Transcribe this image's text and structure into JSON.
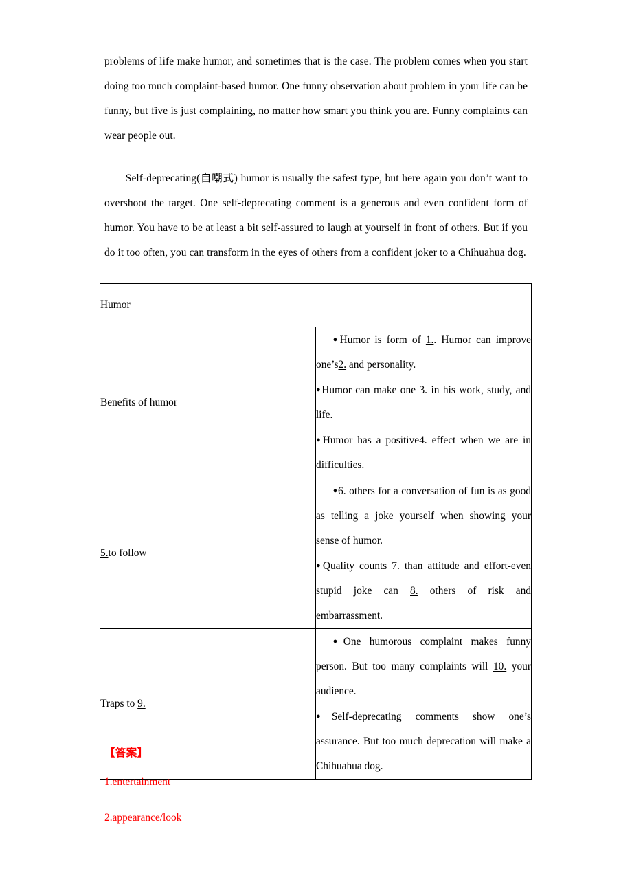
{
  "document": {
    "paragraphs": [
      "problems of life make humor, and sometimes that is the case. The problem comes when you start doing too much complaint-based humor. One funny observation about problem in your life can be funny, but five is just complaining, no matter how smart you think you are. Funny complaints can wear people out.",
      "Self-deprecating(自嘲式) humor is usually the safest type, but here again you don’t want to overshoot the target. One self-deprecating comment is a generous and even confident form of humor. You have to be at least a bit self-assured to laugh at yourself in front of others. But if you do it too often, you can transform in the eyes of others from a confident joker to a Chihuahua dog."
    ],
    "table": {
      "title": "Humor",
      "rows": [
        {
          "label_prefix": "",
          "label_blank": "",
          "label_suffix": "Benefits of humor",
          "bullets": [
            {
              "bullet": "●",
              "segments": [
                {
                  "text": "Humor is form of ",
                  "blank": false
                },
                {
                  "text": "1.",
                  "blank": true
                },
                {
                  "text": ". Humor can improve one’s",
                  "blank": false
                },
                {
                  "text": "2.",
                  "blank": true
                },
                {
                  "text": " and personality.",
                  "blank": false
                }
              ]
            },
            {
              "bullet": "●",
              "segments": [
                {
                  "text": "Humor can make one ",
                  "blank": false
                },
                {
                  "text": "3.",
                  "blank": true
                },
                {
                  "text": " in his work, study, and life.",
                  "blank": false
                }
              ]
            },
            {
              "bullet": "●",
              "segments": [
                {
                  "text": "Humor has a positive",
                  "blank": false
                },
                {
                  "text": "4.",
                  "blank": true
                },
                {
                  "text": " effect when we are in difficulties.",
                  "blank": false
                }
              ]
            }
          ]
        },
        {
          "label_prefix": "",
          "label_blank": "5.",
          "label_suffix": "to follow",
          "bullets": [
            {
              "bullet": "●",
              "segments": [
                {
                  "text": "6.",
                  "blank": true
                },
                {
                  "text": " others for a conversation of fun is as good as telling a joke yourself when showing your sense of humor.",
                  "blank": false
                }
              ]
            },
            {
              "bullet": "●",
              "segments": [
                {
                  "text": "Quality counts ",
                  "blank": false
                },
                {
                  "text": "7.",
                  "blank": true
                },
                {
                  "text": " than attitude and effort-even stupid joke can ",
                  "blank": false
                },
                {
                  "text": "8.",
                  "blank": true
                },
                {
                  "text": " others of risk and embarrassment.",
                  "blank": false
                }
              ]
            }
          ]
        },
        {
          "label_prefix": "Traps to ",
          "label_blank": "9.",
          "label_suffix": "",
          "bullets": [
            {
              "bullet": "●",
              "segments": [
                {
                  "text": "One humorous complaint makes funny person. But too many complaints will ",
                  "blank": false
                },
                {
                  "text": "10.",
                  "blank": true
                },
                {
                  "text": " your audience.",
                  "blank": false
                }
              ]
            },
            {
              "bullet": "●",
              "segments": [
                {
                  "text": "Self-deprecating comments show one’s assurance. But too much deprecation will make a Chihuahua dog.",
                  "blank": false
                }
              ]
            }
          ]
        }
      ]
    },
    "answers": {
      "heading": "【答案】",
      "color": "#ff0000",
      "items": [
        "1.entertainment",
        "2.appearance/look"
      ]
    }
  }
}
